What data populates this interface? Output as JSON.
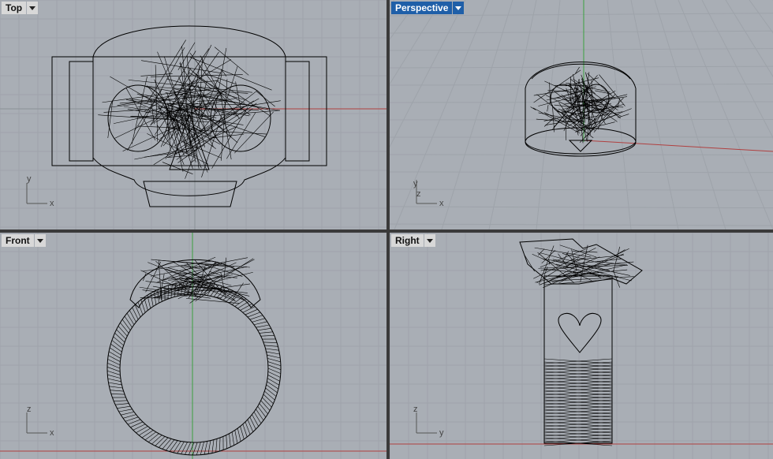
{
  "viewports": {
    "top": {
      "label": "Top",
      "axis_a": "y",
      "axis_b": "x"
    },
    "perspective": {
      "label": "Perspective",
      "axis_a": "y",
      "axis_b": "z",
      "axis_c": "x"
    },
    "front": {
      "label": "Front",
      "axis_a": "z",
      "axis_b": "x"
    },
    "right": {
      "label": "Right",
      "axis_a": "z",
      "axis_b": "y"
    }
  },
  "colors": {
    "viewport_bg": "#a9aeb5",
    "grid_minor": "#9ea3aa",
    "grid_major": "#8c9198",
    "x_axis": "#b04040",
    "y_axis": "#3aa040",
    "wire": "#000000",
    "active_tab": "#1f5fa8"
  },
  "icons": {
    "dropdown": "chevron-down-icon"
  }
}
